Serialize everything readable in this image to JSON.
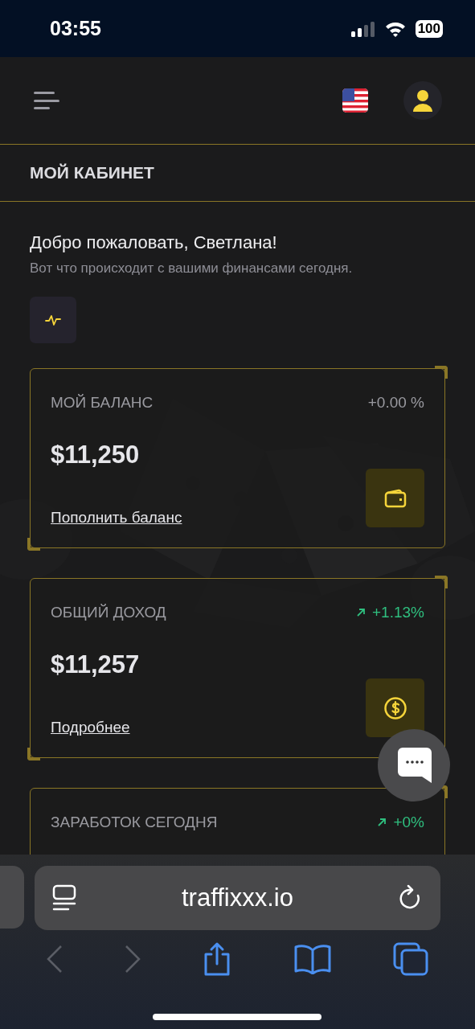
{
  "status_bar": {
    "time": "03:55",
    "battery": "100"
  },
  "header": {
    "page_title": "МОЙ КАБИНЕТ"
  },
  "welcome": {
    "title": "Добро пожаловать, Светлана!",
    "subtitle": "Вот что происходит с вашими финансами сегодня."
  },
  "cards": [
    {
      "title": "МОЙ БАЛАНС",
      "change": "+0.00 %",
      "kind": "flat",
      "amount": "$11,250",
      "link": "Пополнить баланс"
    },
    {
      "title": "ОБЩИЙ ДОХОД",
      "change": "+1.13%",
      "kind": "up",
      "amount": "$11,257",
      "link": "Подробнее"
    },
    {
      "title": "ЗАРАБОТОК СЕГОДНЯ",
      "change": "+0%",
      "kind": "up"
    }
  ],
  "browser": {
    "url": "traffixxx.io"
  }
}
